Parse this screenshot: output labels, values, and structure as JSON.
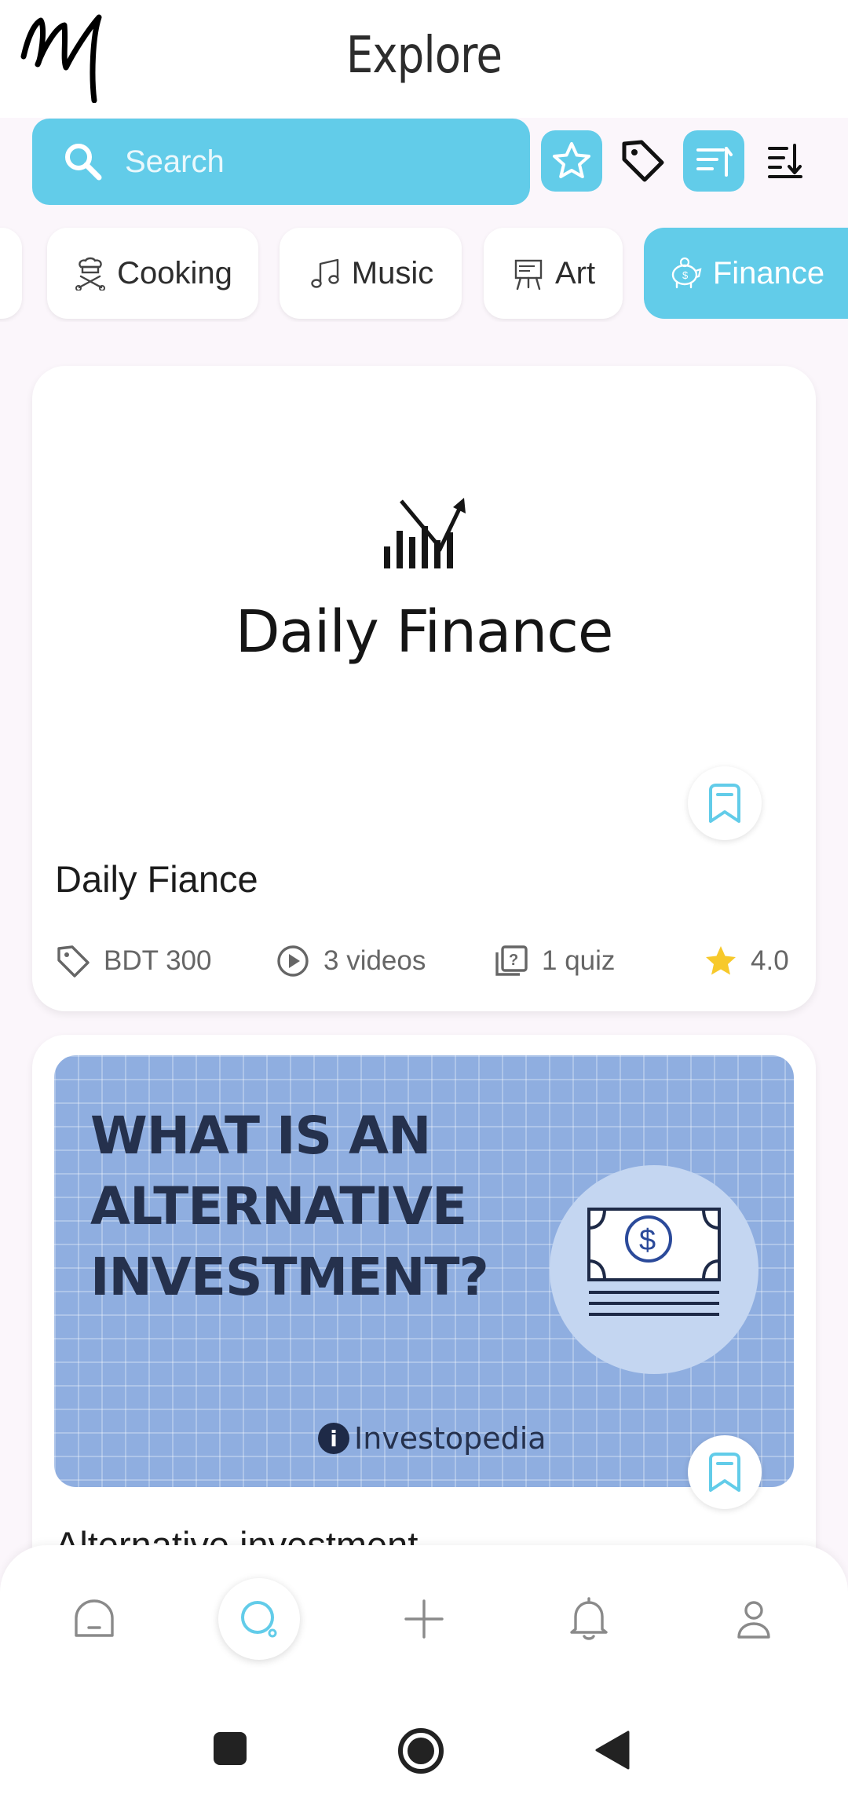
{
  "header": {
    "title": "Explore"
  },
  "search": {
    "placeholder": "Search"
  },
  "toolbar": {
    "icons": [
      "star-icon",
      "tag-icon",
      "filter-icon",
      "sort-icon"
    ]
  },
  "categories": {
    "items": [
      {
        "label": "Cooking",
        "icon": "chef-icon",
        "active": false
      },
      {
        "label": "Music",
        "icon": "music-note-icon",
        "active": false
      },
      {
        "label": "Art",
        "icon": "easel-icon",
        "active": false
      },
      {
        "label": "Finance",
        "icon": "piggy-bank-icon",
        "active": true
      }
    ]
  },
  "courses": [
    {
      "thumbnail_text": "Daily Finance",
      "title": "Daily Fiance",
      "price": "BDT 300",
      "videos": "3 videos",
      "quizzes": "1 quiz",
      "rating": "4.0"
    },
    {
      "thumbnail_lines": [
        "WHAT IS AN",
        "ALTERNATIVE",
        "INVESTMENT?"
      ],
      "thumbnail_brand": "Investopedia",
      "title": "Alternative investment"
    }
  ],
  "bottom_nav": {
    "items": [
      "home-icon",
      "explore-icon",
      "add-icon",
      "bell-icon",
      "profile-icon"
    ],
    "active": "explore-icon"
  },
  "colors": {
    "accent": "#62cce9",
    "star": "#f7c92b",
    "background": "#fbf6fb"
  }
}
